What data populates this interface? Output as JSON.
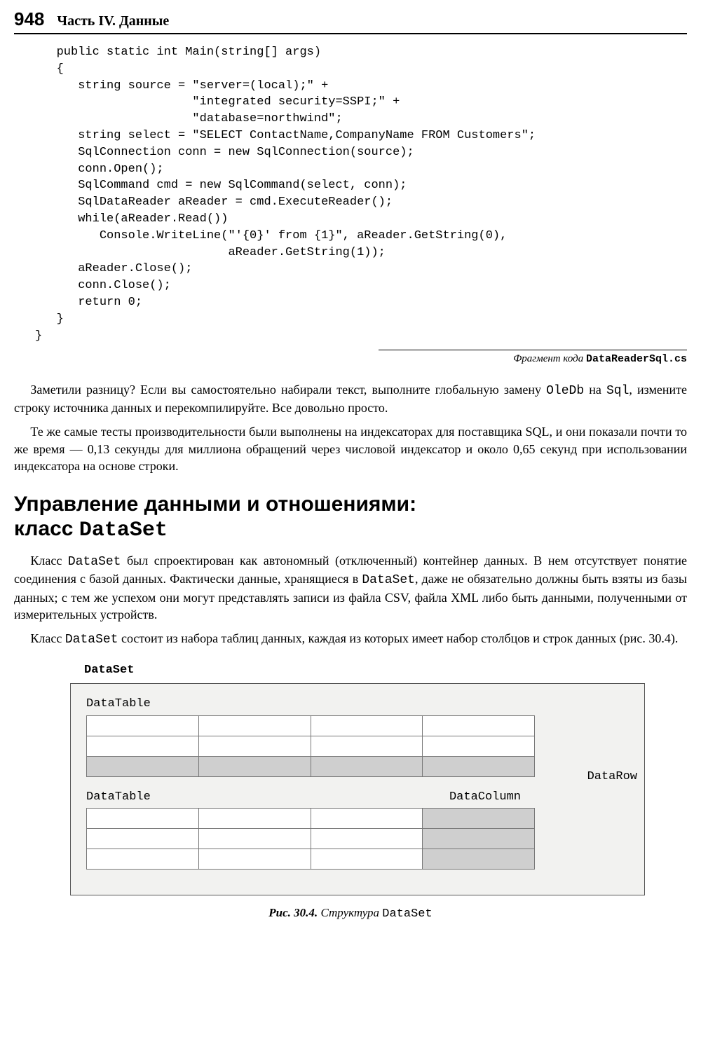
{
  "header": {
    "page_number": "948",
    "part_title": "Часть IV. Данные"
  },
  "code_block": "   public static int Main(string[] args)\n   {\n      string source = \"server=(local);\" +\n                      \"integrated security=SSPI;\" +\n                      \"database=northwind\";\n      string select = \"SELECT ContactName,CompanyName FROM Customers\";\n      SqlConnection conn = new SqlConnection(source);\n      conn.Open();\n      SqlCommand cmd = new SqlCommand(select, conn);\n      SqlDataReader aReader = cmd.ExecuteReader();\n      while(aReader.Read())\n         Console.WriteLine(\"'{0}' from {1}\", aReader.GetString(0),\n                           aReader.GetString(1));\n      aReader.Close();\n      conn.Close();\n      return 0;\n   }\n}",
  "fragment": {
    "prefix": "Фрагмент кода ",
    "filename": "DataReaderSql.cs"
  },
  "para1": {
    "t1": "Заметили разницу? Если вы самостоятельно набирали текст, выполните глобальную замену ",
    "c1": "OleDb",
    "t2": " на ",
    "c2": "Sql",
    "t3": ", измените строку источника данных и перекомпилируйте. Все довольно просто."
  },
  "para2": "Те же самые тесты производительности были выполнены на индексаторах для поставщика SQL, и они показали почти то же время — 0,13 секунды для миллиона обращений через числовой индексатор и около 0,65 секунд при использовании индексатора на основе строки.",
  "heading": {
    "line1": "Управление данными и отношениями:",
    "line2_pre": "класс ",
    "line2_mono": "DataSet"
  },
  "para3": {
    "t1": "Класс ",
    "c1": "DataSet",
    "t2": " был спроектирован как автономный (отключенный) контейнер данных. В нем отсутствует понятие соединения с базой данных. Фактически данные, хранящиеся в ",
    "c2": "DataSet",
    "t3": ", даже не обязательно должны быть взяты из базы данных; с тем же успехом они могут представлять записи из файла CSV, файла XML либо быть данными, полученными от измерительных устройств."
  },
  "para4": {
    "t1": "Класс ",
    "c1": "DataSet",
    "t2": " состоит из набора таблиц данных, каждая из которых имеет набор столбцов и строк данных (рис. 30.4)."
  },
  "figure": {
    "dataset_label": "DataSet",
    "datatable_label": "DataTable",
    "datacolumn_label": "DataColumn",
    "datarow_label": "DataRow",
    "caption_prefix": "Рис. 30.4.",
    "caption_text": " Структура ",
    "caption_mono": "DataSet"
  }
}
